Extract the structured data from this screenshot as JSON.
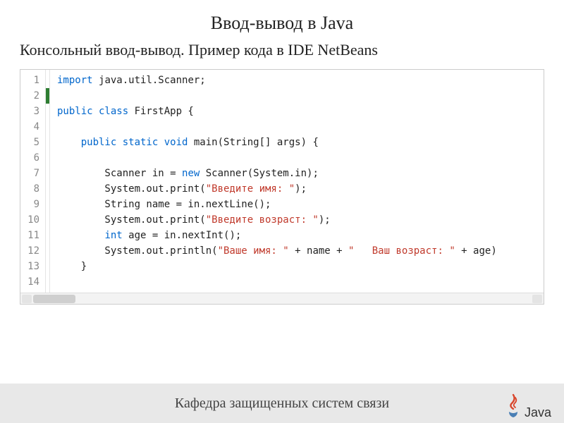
{
  "title": "Ввод-вывод в Java",
  "subtitle": "Консольный ввод-вывод. Пример кода в IDE NetBeans",
  "code": {
    "lines": [
      {
        "n": 1,
        "marker": "",
        "tokens": [
          [
            "kw",
            "import "
          ],
          [
            "plain",
            "java.util.Scanner;"
          ]
        ]
      },
      {
        "n": 2,
        "marker": "green",
        "tokens": []
      },
      {
        "n": 3,
        "marker": "",
        "tokens": [
          [
            "kw",
            "public class "
          ],
          [
            "plain",
            "FirstApp {"
          ]
        ]
      },
      {
        "n": 4,
        "marker": "",
        "tokens": []
      },
      {
        "n": 5,
        "marker": "",
        "tokens": [
          [
            "plain",
            "    "
          ],
          [
            "kw",
            "public static void "
          ],
          [
            "plain",
            "main(String[] args) {"
          ]
        ]
      },
      {
        "n": 6,
        "marker": "",
        "tokens": []
      },
      {
        "n": 7,
        "marker": "",
        "tokens": [
          [
            "plain",
            "        Scanner in = "
          ],
          [
            "kw",
            "new "
          ],
          [
            "plain",
            "Scanner(System.in);"
          ]
        ]
      },
      {
        "n": 8,
        "marker": "",
        "tokens": [
          [
            "plain",
            "        System.out.print("
          ],
          [
            "str",
            "\"Введите имя: \""
          ],
          [
            "plain",
            ");"
          ]
        ]
      },
      {
        "n": 9,
        "marker": "",
        "tokens": [
          [
            "plain",
            "        String name = in.nextLine();"
          ]
        ]
      },
      {
        "n": 10,
        "marker": "",
        "tokens": [
          [
            "plain",
            "        System.out.print("
          ],
          [
            "str",
            "\"Введите возраст: \""
          ],
          [
            "plain",
            ");"
          ]
        ]
      },
      {
        "n": 11,
        "marker": "",
        "tokens": [
          [
            "plain",
            "        "
          ],
          [
            "kw",
            "int "
          ],
          [
            "plain",
            "age = in.nextInt();"
          ]
        ]
      },
      {
        "n": 12,
        "marker": "",
        "tokens": [
          [
            "plain",
            "        System.out.println("
          ],
          [
            "str",
            "\"Ваше имя: \""
          ],
          [
            "plain",
            " + name + "
          ],
          [
            "str",
            "\"   Ваш возраст: \""
          ],
          [
            "plain",
            " + age)"
          ]
        ]
      },
      {
        "n": 13,
        "marker": "",
        "tokens": [
          [
            "plain",
            "    }"
          ]
        ]
      },
      {
        "n": 14,
        "marker": "",
        "tokens": []
      }
    ]
  },
  "footer": "Кафедра защищенных систем связи",
  "logo_text": "Java"
}
